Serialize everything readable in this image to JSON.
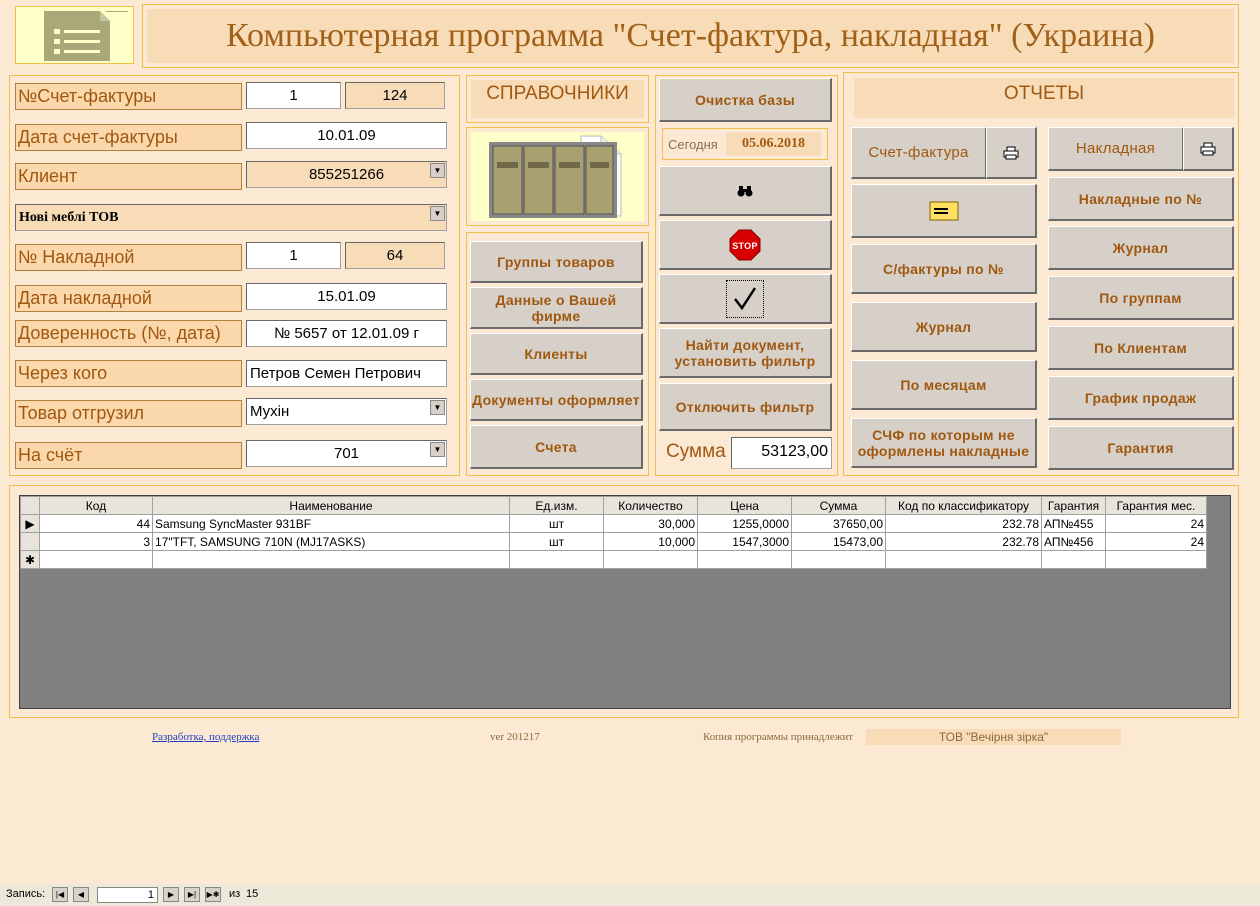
{
  "header": {
    "title": "Компьютерная программа \"Счет-фактура, накладная\" (Украина)"
  },
  "form": {
    "invoice_no_label": "№Счет-фактуры",
    "invoice_no": "1",
    "invoice_no_count": "124",
    "invoice_date_label": "Дата счет-фактуры",
    "invoice_date": "10.01.09",
    "client_label": "Клиент",
    "client_code": "855251266",
    "client_name": "Нові меблі ТОВ",
    "waybill_no_label": "№ Накладной",
    "waybill_no": "1",
    "waybill_no_count": "64",
    "waybill_date_label": "Дата накладной",
    "waybill_date": "15.01.09",
    "proxy_label": "Доверенность (№, дата)",
    "proxy": "№ 5657 от 12.01.09 г",
    "via_label": "Через кого",
    "via": "Петров Семен Петрович",
    "shipped_label": "Товар отгрузил",
    "shipped_by": "Мухін",
    "account_label": "На счёт",
    "account": "701"
  },
  "references": {
    "title": "СПРАВОЧНИКИ",
    "buttons": [
      "Группы товаров",
      "Данные о Вашей фирме",
      "Клиенты",
      "Документы оформляет",
      "Счета"
    ]
  },
  "middle": {
    "clear_db": "Очистка базы",
    "today_label": "Сегодня",
    "today": "05.06.2018",
    "find_filter": "Найти документ, установить фильтр",
    "disable_filter": "Отключить фильтр",
    "sum_label": "Сумма",
    "sum": "53123,00"
  },
  "reports": {
    "title": "ОТЧЕТЫ",
    "invoice": "Счет-фактура",
    "waybill": "Накладная",
    "left": [
      "С/фактуры по №",
      "Журнал",
      "По месяцам",
      "СЧФ по которым не оформлены накладные"
    ],
    "right": [
      "Накладные по №",
      "Журнал",
      "По группам",
      "По Клиентам",
      "График продаж",
      "Гарантия"
    ]
  },
  "grid": {
    "columns": [
      "Код",
      "Наименование",
      "Ед.изм.",
      "Количество",
      "Цена",
      "Сумма",
      "Код по классификатору",
      "Гарантия",
      "Гарантия мес."
    ],
    "rows": [
      [
        "44",
        "Samsung SyncMaster 931BF",
        "шт",
        "30,000",
        "1255,0000",
        "37650,00",
        "232.78",
        "АП№455",
        "24"
      ],
      [
        "3",
        "17\"TFT, SAMSUNG 710N (MJ17ASKS)",
        "шт",
        "10,000",
        "1547,3000",
        "15473,00",
        "232.78",
        "АП№456",
        "24"
      ]
    ]
  },
  "footer": {
    "dev_link": "Разработка, поддержка",
    "version": "ver 201217",
    "owner_label": "Копия программы принадлежит",
    "owner": "ТОВ \"Вечірня зірка\""
  },
  "nav": {
    "record_label": "Запись:",
    "current": "1",
    "of_label": "из",
    "total": "15"
  }
}
